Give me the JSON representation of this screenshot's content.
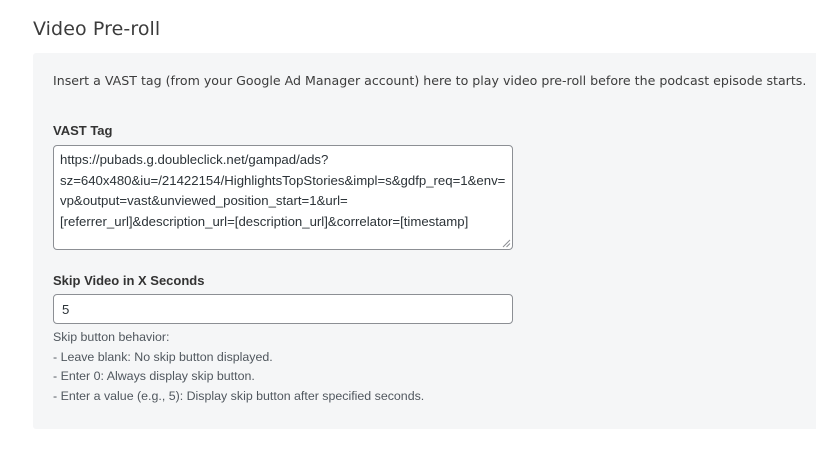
{
  "section": {
    "title": "Video Pre-roll"
  },
  "panel": {
    "intro": "Insert a VAST tag (from your Google Ad Manager account) here to play video pre-roll before the podcast episode starts."
  },
  "vast_tag": {
    "label": "VAST Tag",
    "value": "https://pubads.g.doubleclick.net/gampad/ads?sz=640x480&iu=/21422154/HighlightsTopStories&impl=s&gdfp_req=1&env=vp&output=vast&unviewed_position_start=1&url=[referrer_url]&description_url=[description_url]&correlator=[timestamp]"
  },
  "skip_video": {
    "label": "Skip Video in X Seconds",
    "value": "5",
    "help": {
      "heading": "Skip button behavior:",
      "items": [
        "- Leave blank: No skip button displayed.",
        "- Enter 0: Always display skip button.",
        "- Enter a value (e.g., 5): Display skip button after specified seconds."
      ]
    }
  }
}
